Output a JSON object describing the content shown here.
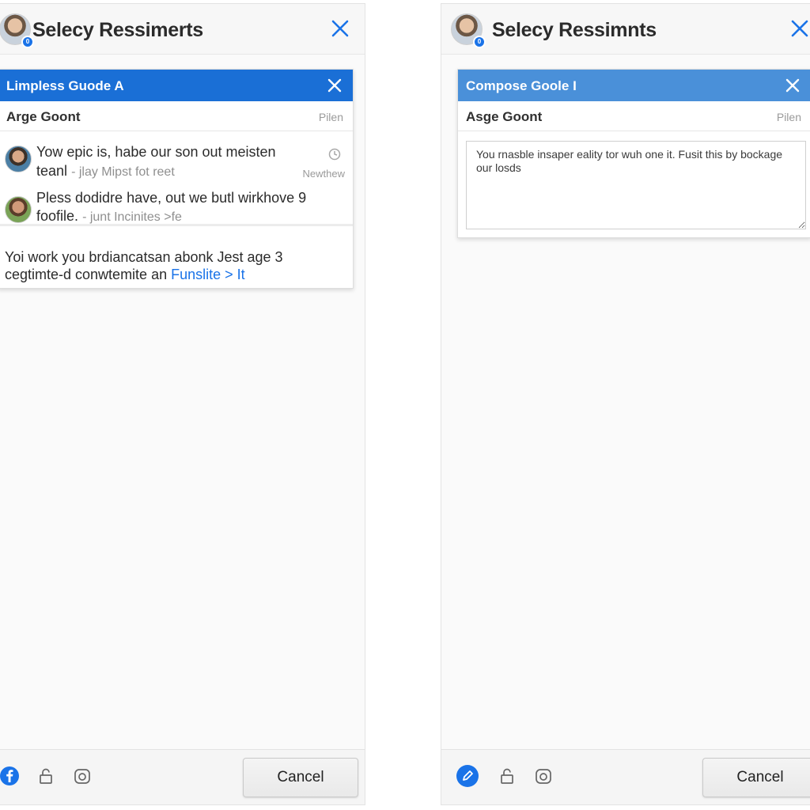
{
  "colors": {
    "accent": "#1a73e8",
    "left_bar": "#1a6fd6",
    "right_bar": "#4a90d9",
    "panel_bg": "#fafafa"
  },
  "left_panel": {
    "title": "Selecy Ressimerts",
    "avatar_badge": "0",
    "close_icon": "close-icon",
    "card": {
      "bar_title": "Limpless Guode A",
      "sub_title": "Arge Goont",
      "sub_right": "Pilen",
      "messages": [
        {
          "line1": "Yow epic is, habe our son out meisten",
          "line2": "teanl",
          "meta": "- jlay Mipst fot reet",
          "time": "Newthew",
          "status_icon": "clock-icon"
        },
        {
          "line1": "Pless dodidre have, out we butl wirkhove 9",
          "line2": "foofile.",
          "meta": "- junt Incinites >fe"
        }
      ],
      "footer_line1": "Yoi work you brdiancatsan abonk Jest age 3",
      "footer_line2": "cegtimte-d conwtemite an",
      "footer_link": "Funslite > It"
    },
    "footer": {
      "icons": [
        "facebook-icon",
        "lock-icon",
        "camera-icon"
      ],
      "cancel_label": "Cancel"
    }
  },
  "right_panel": {
    "title": "Selecy Ressimnts",
    "avatar_badge": "0",
    "close_icon": "close-icon",
    "card": {
      "bar_title": "Compose Goole I",
      "sub_title": "Asge Goont",
      "sub_right": "Pilen",
      "compose_text": "You rnasble insaper eality tor wuh one it. Fusit this by bockage our losds"
    },
    "footer": {
      "icons": [
        "edit-icon",
        "lock-icon",
        "camera-icon"
      ],
      "cancel_label": "Cancel"
    }
  }
}
